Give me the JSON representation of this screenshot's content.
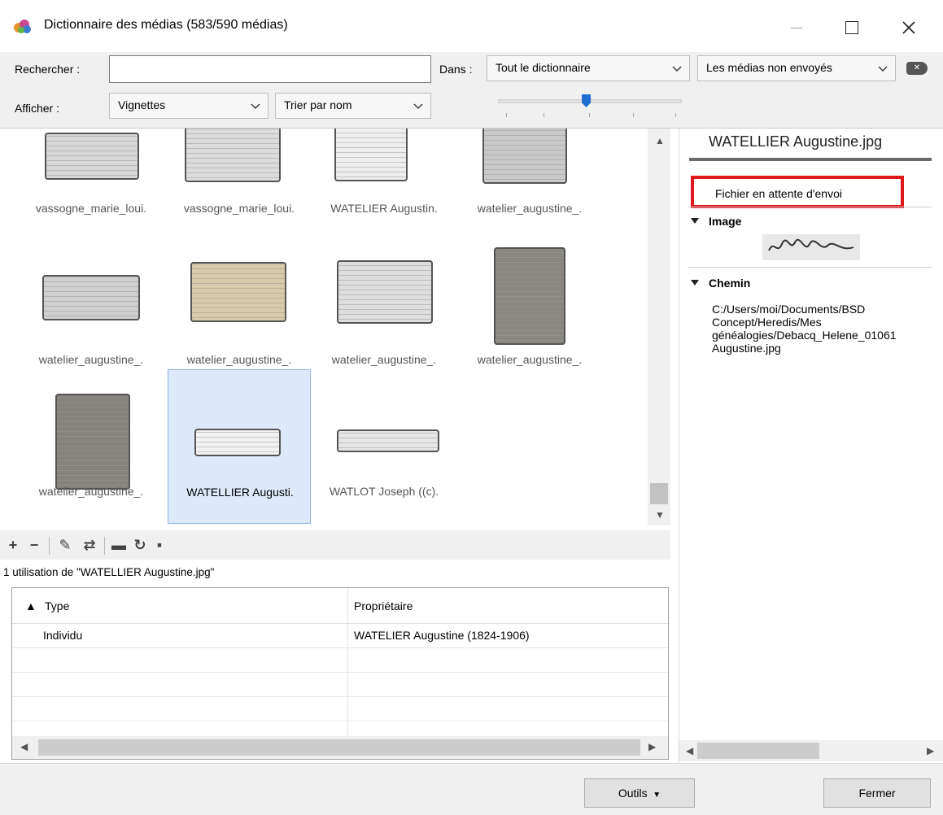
{
  "window": {
    "title": "Dictionnaire des médias (583/590 médias)",
    "minimize_glyph": "—",
    "maximize_glyph": "☐",
    "close_glyph": "✕"
  },
  "toolbar": {
    "search_label": "Rechercher :",
    "search_value": "",
    "scope_label": "Dans :",
    "scope_value": "Tout le dictionnaire",
    "filter_value": "Les médias non envoyés",
    "display_label": "Afficher :",
    "display_value": "Vignettes",
    "sort_value": "Trier par nom",
    "thumb_size_level": 0.48
  },
  "grid": {
    "items": [
      {
        "caption": "vassogne_marie_loui.",
        "tone": "#d8d8d8"
      },
      {
        "caption": "vassogne_marie_loui.",
        "tone": "#dcdcdc"
      },
      {
        "caption": "WATELIER Augustin.",
        "tone": "#eeeeee"
      },
      {
        "caption": "watelier_augustine_.",
        "tone": "#c9c9c9"
      },
      {
        "caption": "watelier_augustine_.",
        "tone": "#d0d0d0"
      },
      {
        "caption": "watelier_augustine_.",
        "tone": "#d9cba9"
      },
      {
        "caption": "watelier_augustine_.",
        "tone": "#dedede"
      },
      {
        "caption": "watelier_augustine_.",
        "tone": "#8a8680"
      },
      {
        "caption": "watelier_augustine_.",
        "tone": "#86827c"
      },
      {
        "caption": "WATELLIER Augusti.",
        "tone": "#f2f2f2"
      },
      {
        "caption": "WATLOT Joseph ((c).",
        "tone": "#e6e6e6"
      }
    ],
    "selected_index": 9
  },
  "usage": {
    "summary": "1 utilisation de \"WATELLIER Augustine.jpg\"",
    "columns": [
      "Type",
      "Propriétaire"
    ],
    "rows": [
      {
        "type": "Individu",
        "owner": "WATELIER Augustine (1824-1906)"
      }
    ]
  },
  "details": {
    "file_name": "WATELLIER Augustine.jpg",
    "status": "Fichier en attente d'envoi",
    "image_section": "Image",
    "path_section": "Chemin",
    "path": "C:/Users/moi/Documents/BSD Concept/Heredis/Mes généalogies/Debacq_Helene_01061 Augustine.jpg"
  },
  "footer": {
    "tools_label": "Outils",
    "close_label": "Fermer"
  },
  "colors": {
    "highlight": "#e0181c",
    "selection": "#dde9fa",
    "accent": "#1e6fd4"
  }
}
